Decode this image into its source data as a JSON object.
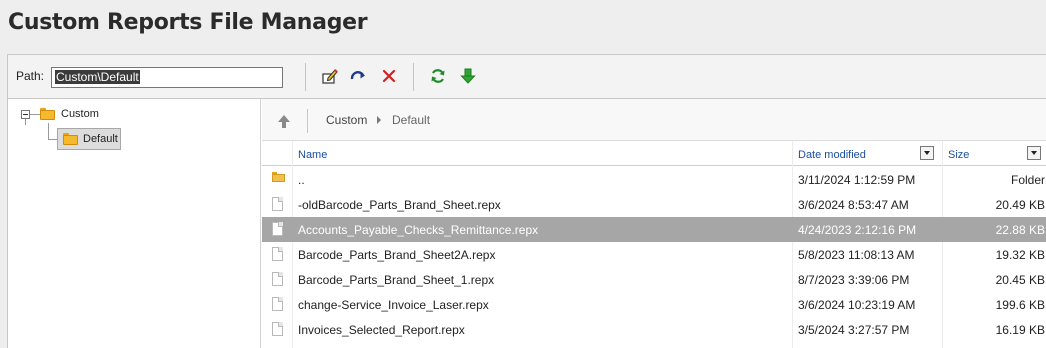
{
  "page": {
    "title": "Custom Reports File Manager"
  },
  "toolbar": {
    "path_label": "Path:",
    "path_value": "Custom\\Default",
    "buttons": [
      {
        "id": "rename",
        "icon": "rename-icon"
      },
      {
        "id": "move",
        "icon": "move-icon"
      },
      {
        "id": "delete",
        "icon": "delete-icon"
      },
      {
        "id": "refresh",
        "icon": "refresh-icon"
      },
      {
        "id": "download",
        "icon": "download-icon"
      }
    ]
  },
  "tree": {
    "root": {
      "label": "Custom",
      "expanded": true
    },
    "children": [
      {
        "label": "Default",
        "selected": true
      }
    ]
  },
  "breadcrumb": {
    "items": [
      "Custom",
      "Default"
    ]
  },
  "grid": {
    "columns": {
      "name": "Name",
      "date": "Date modified",
      "size": "Size"
    },
    "rows": [
      {
        "type": "folder",
        "name": "..",
        "date": "3/11/2024 1:12:59 PM",
        "size": "Folder",
        "selected": false
      },
      {
        "type": "file",
        "name": "-oldBarcode_Parts_Brand_Sheet.repx",
        "date": "3/6/2024 8:53:47 AM",
        "size": "20.49 KB",
        "selected": false
      },
      {
        "type": "file",
        "name": "Accounts_Payable_Checks_Remittance.repx",
        "date": "4/24/2023 2:12:16 PM",
        "size": "22.88 KB",
        "selected": true
      },
      {
        "type": "file",
        "name": "Barcode_Parts_Brand_Sheet2A.repx",
        "date": "5/8/2023 11:08:13 AM",
        "size": "19.32 KB",
        "selected": false
      },
      {
        "type": "file",
        "name": "Barcode_Parts_Brand_Sheet_1.repx",
        "date": "8/7/2023 3:39:06 PM",
        "size": "20.45 KB",
        "selected": false
      },
      {
        "type": "file",
        "name": "change-Service_Invoice_Laser.repx",
        "date": "3/6/2024 10:23:19 AM",
        "size": "199.6 KB",
        "selected": false
      },
      {
        "type": "file",
        "name": "Invoices_Selected_Report.repx",
        "date": "3/5/2024 3:27:57 PM",
        "size": "16.19 KB",
        "selected": false
      }
    ]
  }
}
